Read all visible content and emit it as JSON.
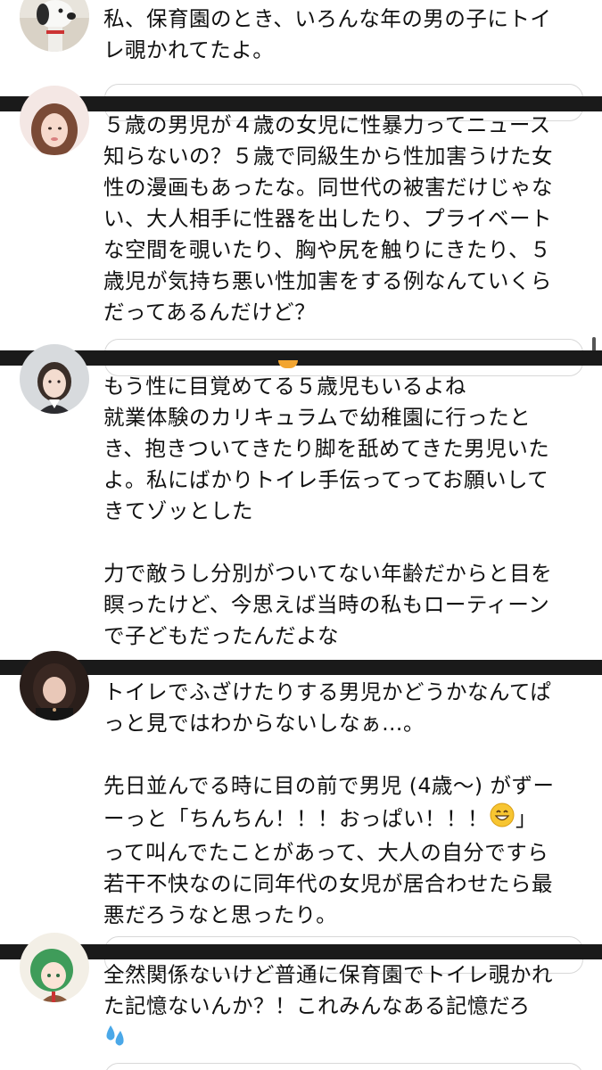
{
  "comments": [
    {
      "avatar_icon": "snoopy-avatar-icon",
      "text": "私、保育園のとき、いろんな年の男の子にトイ\nレ覗かれてたよ。"
    },
    {
      "avatar_icon": "woman-avatar-icon",
      "text": "５歳の男児が４歳の女児に性暴力ってニュース\n知らないの？５歳で同級生から性加害うけた女\n性の漫画もあったな。同世代の被害だけじゃな\nい、大人相手に性器を出したり、プライベート\nな空間を覗いたり、胸や尻を触りにきたり、５\n歳児が気持ち悪い性加害をする例なんていくら\nだってあるんだけど？"
    },
    {
      "avatar_icon": "woman-portrait-avatar-icon",
      "text": "もう性に目覚めてる５歳児もいるよね\n就業体験のカリキュラムで幼稚園に行ったと\nき、抱きついてきたり脚を舐めてきた男児いた\nよ。私にばかりトイレ手伝ってってお願いして\nきてゾッとした\n\n力で敵うし分別がついてない年齢だからと目を\n瞑ったけど、今思えば当時の私もローティーン\nで子どもだったんだよな"
    },
    {
      "avatar_icon": "dark-hair-avatar-icon",
      "text": "トイレでふざけたりする男児かどうかなんてぱ\nっと見ではわからないしなぁ…。\n\n先日並んでる時に目の前で男児 (4歳〜) がずー\nーっと「ちんちん！！！おっぱい！！！",
      "emoji_icon": "grinning-emoji-icon",
      "text_after_emoji": "」\nって叫んでたことがあって、大人の自分ですら\n若干不快なのに同年代の女児が居合わせたら最\n悪だろうなと思ったり。"
    },
    {
      "avatar_icon": "anime-girl-avatar-icon",
      "text": "全然関係ないけど普通に保育園でトイレ覗かれ\nた記憶ないんか？！これみんなある記憶だろ\n",
      "emoji_icon": "sweat-droplets-emoji-icon"
    }
  ],
  "colors": {
    "divider": "#1a1a1a",
    "text": "#111111",
    "reply_border": "#d8d8d8"
  }
}
